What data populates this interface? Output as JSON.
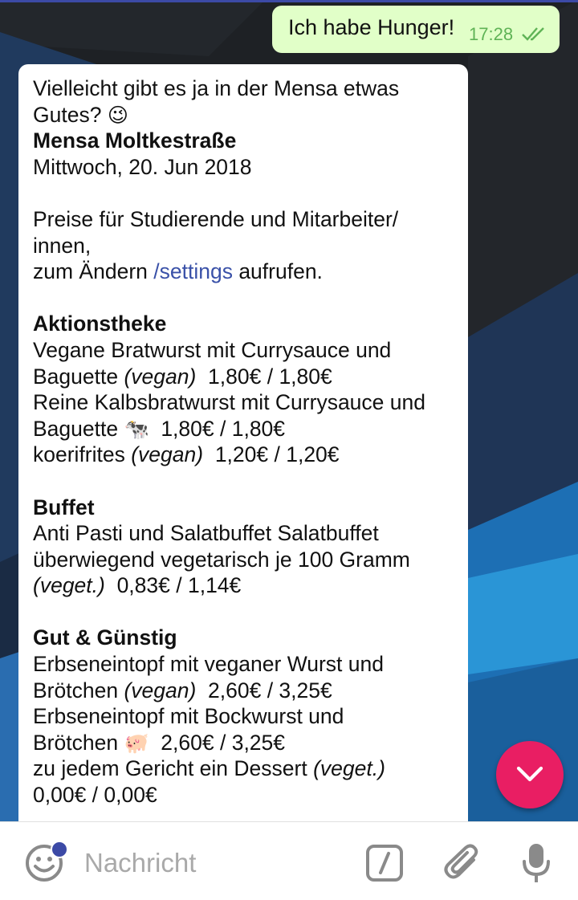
{
  "colors": {
    "outgoing_bubble": "#e1ffc8",
    "incoming_bubble": "#ffffff",
    "link": "#3a51a8",
    "fab": "#e91e63",
    "badge_dot": "#3c4aa6"
  },
  "outgoing": {
    "text": "Ich habe Hunger!",
    "time": "17:28",
    "status_icon": "double-check-icon"
  },
  "incoming": {
    "intro_line1": "Vielleicht gibt es ja in der Mensa etwas",
    "intro_line2": "Gutes?",
    "intro_emoji": "😉",
    "mensa_name": "Mensa Moltkestraße",
    "date": "Mittwoch, 20. Jun 2018",
    "prices_line1": "Preise für Studierende und Mitarbeiter/",
    "prices_line2": "innen,",
    "prices_line3_pre": "zum Ändern ",
    "prices_line3_link": "/settings",
    "prices_line3_post": " aufrufen.",
    "sections": {
      "aktion": {
        "title": "Aktionstheke",
        "item1_l1": "Vegane Bratwurst mit Currysauce und",
        "item1_l2_pre": "Baguette ",
        "item1_tag": "(vegan)",
        "item1_price": "  1,80€ / 1,80€",
        "item2_l1": "Reine Kalbsbratwurst mit Currysauce und",
        "item2_l2_pre": "Baguette ",
        "item2_emoji": "🐄",
        "item2_price": "  1,80€ / 1,80€",
        "item3_pre": "koerifrites ",
        "item3_tag": "(vegan)",
        "item3_price": "  1,20€ / 1,20€"
      },
      "buffet": {
        "title": "Buffet",
        "item1_l1": "Anti Pasti und Salatbuffet Salatbuffet",
        "item1_l2": "überwiegend vegetarisch je 100 Gramm",
        "item1_tag": "(veget.)",
        "item1_price": "  0,83€ / 1,14€"
      },
      "gut": {
        "title": "Gut & Günstig",
        "item1_l1": "Erbseneintopf mit veganer Wurst und",
        "item1_l2_pre": "Brötchen ",
        "item1_tag": "(vegan)",
        "item1_price": "  2,60€ / 3,25€",
        "item2_l1": "Erbseneintopf mit Bockwurst und",
        "item2_l2_pre": "Brötchen ",
        "item2_emoji": "🐖",
        "item2_price": "  2,60€ / 3,25€",
        "item3_pre": "zu jedem Gericht ein Dessert ",
        "item3_tag": "(veget.)",
        "item3_price": "0,00€ / 0,00€"
      }
    }
  },
  "fab_icon": "chevron-down-icon",
  "input": {
    "placeholder": "Nachricht",
    "emoji_icon": "smiley-icon",
    "command_icon": "slash-command-icon",
    "attach_icon": "paperclip-icon",
    "mic_icon": "microphone-icon"
  }
}
